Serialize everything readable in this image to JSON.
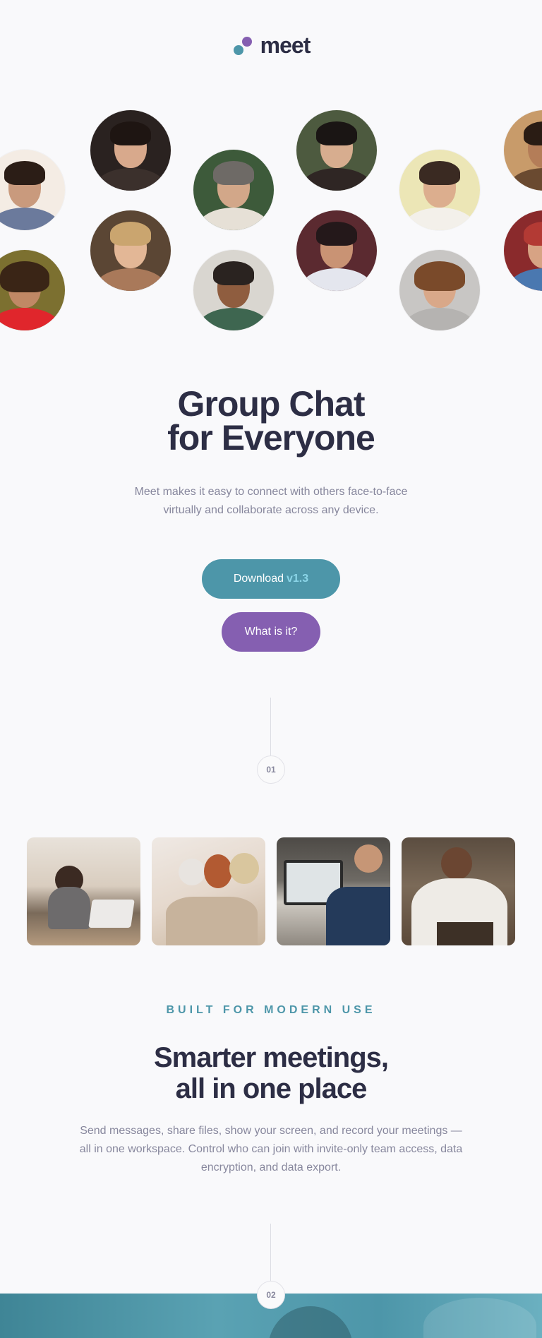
{
  "header": {
    "brand": "meet",
    "logo_icon": "two-dots-logo-icon"
  },
  "colors": {
    "primary": "#4d96a9",
    "secondary": "#855fb1",
    "heading": "#2d2e45",
    "body": "#87879d",
    "accent_light": "#8bd5e8"
  },
  "avatars": [
    {
      "name": "avatar-man-dark-hair"
    },
    {
      "name": "avatar-woman-smiling"
    },
    {
      "name": "avatar-man-gray-hair"
    },
    {
      "name": "avatar-man-sunglasses"
    },
    {
      "name": "avatar-man-laughing"
    },
    {
      "name": "avatar-man-beard"
    },
    {
      "name": "avatar-man-curly-hair"
    },
    {
      "name": "avatar-woman-blonde"
    },
    {
      "name": "avatar-older-man"
    },
    {
      "name": "avatar-man-flowers"
    },
    {
      "name": "avatar-young-man"
    },
    {
      "name": "avatar-man-partial-right"
    },
    {
      "name": "avatar-woman-partial-right"
    }
  ],
  "hero": {
    "title_line1": "Group Chat",
    "title_line2": "for Everyone",
    "description": "Meet makes it easy to connect with others face-to-face virtually and collaborate across any device.",
    "download_label": "Download",
    "download_version": "v1.3",
    "what_label": "What is it?"
  },
  "steps": {
    "first": "01",
    "second": "02"
  },
  "photos": [
    {
      "name": "photo-woman-laptop"
    },
    {
      "name": "photo-women-phone"
    },
    {
      "name": "photo-man-video-call"
    },
    {
      "name": "photo-man-phone"
    }
  ],
  "section": {
    "eyebrow": "BUILT FOR MODERN USE",
    "title_line1": "Smarter meetings,",
    "title_line2": "all in one place",
    "description": "Send messages, share files, show your screen, and record your meetings — all in one workspace. Control who can join with invite-only team access, data encryption, and data export."
  }
}
